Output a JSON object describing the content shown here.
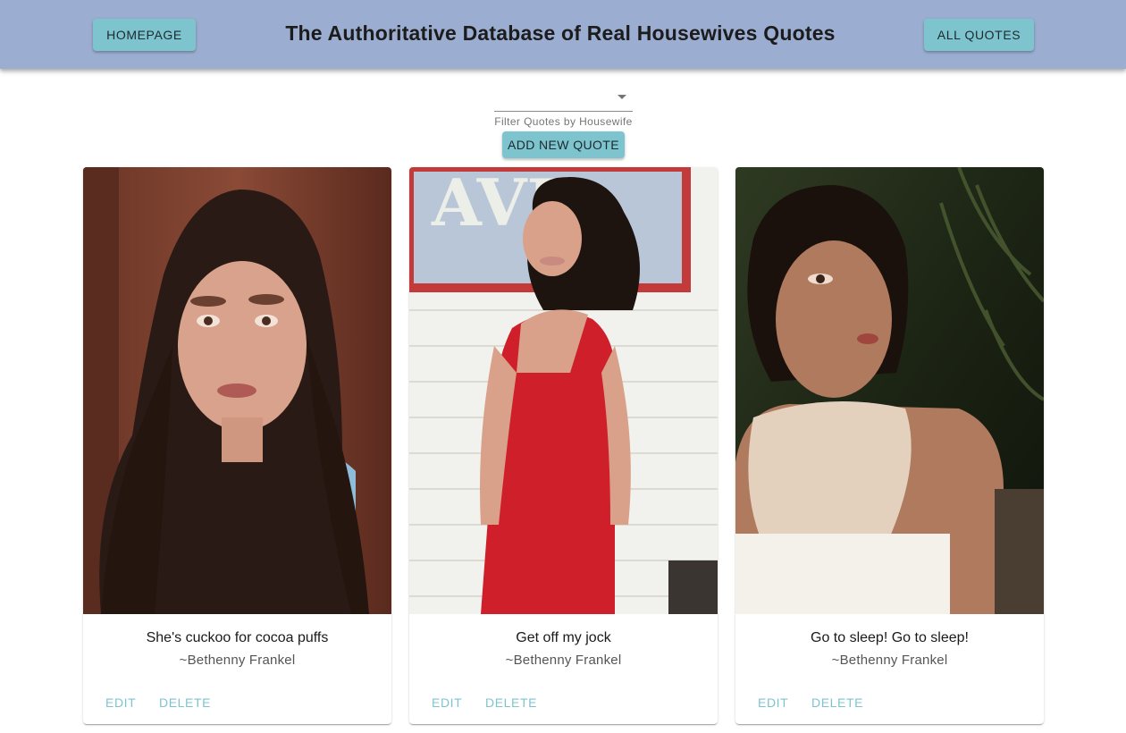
{
  "header": {
    "title": "The Authoritative Database of Real Housewives Quotes",
    "homepage_label": "HOMEPAGE",
    "all_quotes_label": "ALL QUOTES",
    "color": "#9baed1"
  },
  "filter": {
    "selected": "",
    "label": "Filter Quotes by Housewife"
  },
  "add_button_label": "ADD NEW QUOTE",
  "accent_color": "#7ec4cf",
  "cards": [
    {
      "quote": "She's cuckoo for cocoa puffs",
      "author": "~Bethenny Frankel",
      "edit_label": "EDIT",
      "delete_label": "DELETE"
    },
    {
      "quote": "Get off my jock",
      "author": "~Bethenny Frankel",
      "edit_label": "EDIT",
      "delete_label": "DELETE"
    },
    {
      "quote": "Go to sleep! Go to sleep!",
      "author": "~Bethenny Frankel",
      "edit_label": "EDIT",
      "delete_label": "DELETE"
    }
  ]
}
